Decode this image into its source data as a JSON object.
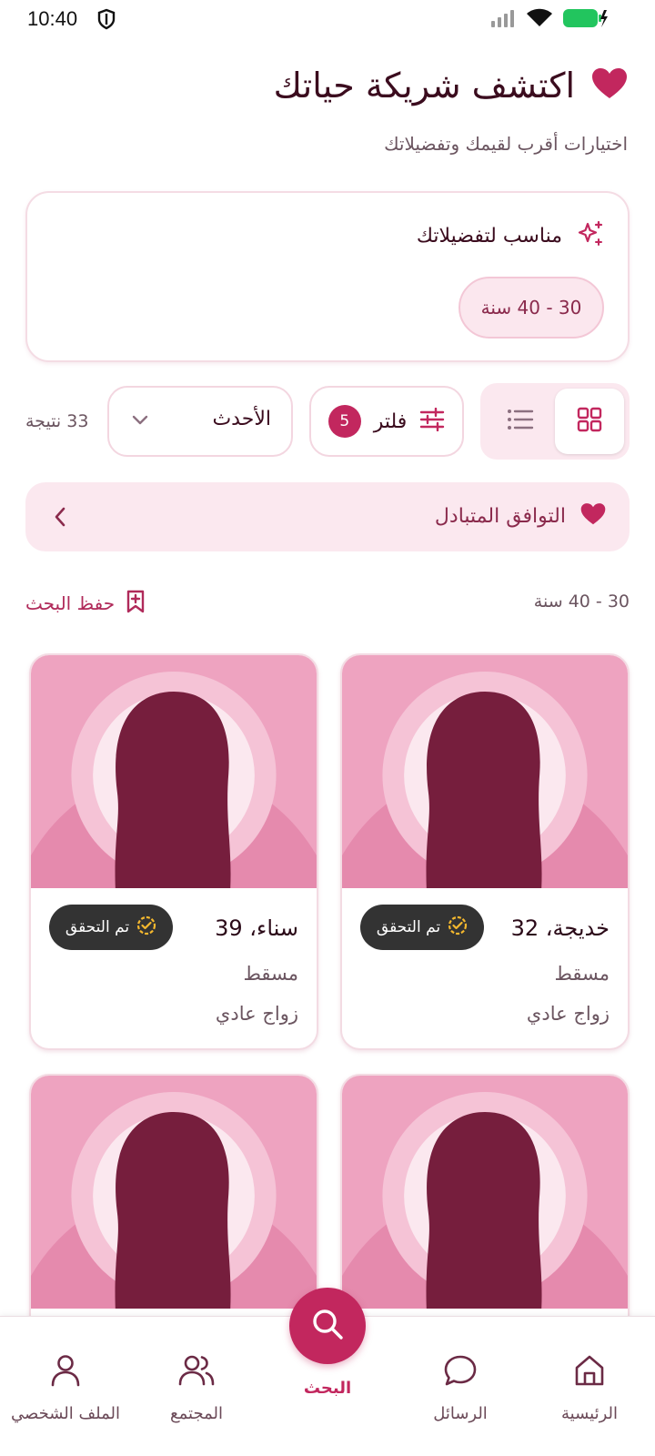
{
  "status": {
    "time": "10:40"
  },
  "header": {
    "title": "اكتشف شريكة حياتك",
    "subtitle": "اختيارات أقرب لقيمك وتفضيلاتك"
  },
  "preferences": {
    "title": "مناسب لتفضيلاتك",
    "age_chip": "30 - 40 سنة"
  },
  "controls": {
    "filter_label": "فلتر",
    "filter_count": "5",
    "sort_value": "الأحدث",
    "result_count": "33 نتيجة",
    "view_mode": "grid"
  },
  "mutual": {
    "label": "التوافق المتبادل"
  },
  "search_bar": {
    "range": "30 - 40 سنة",
    "save_label": "حفظ البحث"
  },
  "profiles": [
    {
      "name": "خديجة، 32",
      "verified": "تم التحقق",
      "city": "مسقط",
      "marriage_type": "زواج عادي"
    },
    {
      "name": "سناء، 39",
      "verified": "تم التحقق",
      "city": "مسقط",
      "marriage_type": "زواج عادي"
    }
  ],
  "nav": {
    "home": "الرئيسية",
    "messages": "الرسائل",
    "search": "البحث",
    "community": "المجتمع",
    "profile": "الملف الشخصي",
    "active": "search"
  },
  "colors": {
    "accent": "#c2275e",
    "accent_soft": "#fbe8ef",
    "avatar_bg": "#eea3c0",
    "avatar_hair": "#761e3d"
  }
}
